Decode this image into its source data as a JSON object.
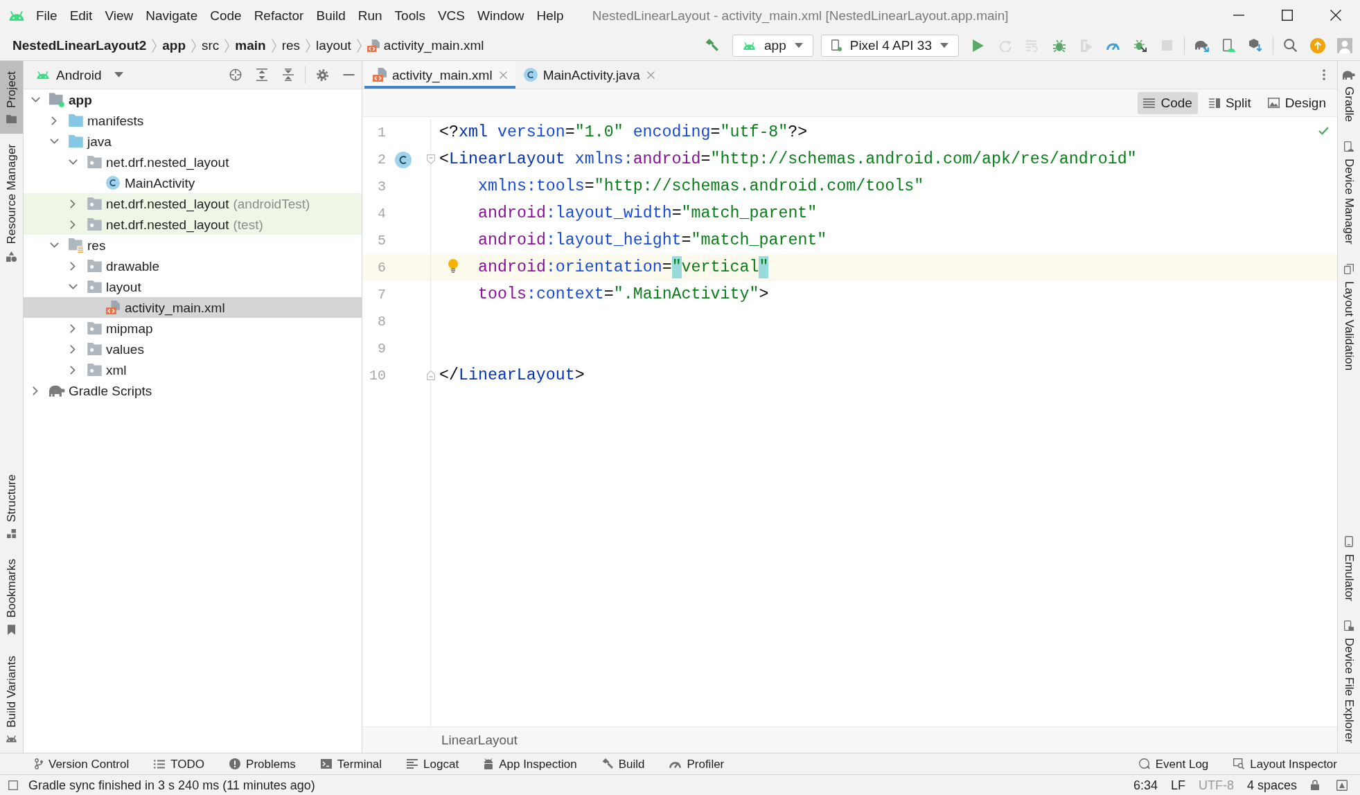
{
  "window": {
    "title": "NestedLinearLayout - activity_main.xml [NestedLinearLayout.app.main]"
  },
  "menu": [
    {
      "label": "File"
    },
    {
      "label": "Edit"
    },
    {
      "label": "View"
    },
    {
      "label": "Navigate"
    },
    {
      "label": "Code"
    },
    {
      "label": "Refactor"
    },
    {
      "label": "Build"
    },
    {
      "label": "Run"
    },
    {
      "label": "Tools"
    },
    {
      "label": "VCS"
    },
    {
      "label": "Window"
    },
    {
      "label": "Help"
    }
  ],
  "breadcrumbs": [
    {
      "label": "NestedLinearLayout2",
      "bold": true,
      "kind": "folder"
    },
    {
      "label": "app",
      "bold": true,
      "kind": "folder"
    },
    {
      "label": "src",
      "bold": false,
      "kind": "folder"
    },
    {
      "label": "main",
      "bold": true,
      "kind": "folder"
    },
    {
      "label": "res",
      "bold": false,
      "kind": "folder"
    },
    {
      "label": "layout",
      "bold": false,
      "kind": "folder"
    },
    {
      "label": "activity_main.xml",
      "bold": false,
      "kind": "layout-file"
    }
  ],
  "toolbar": {
    "make_button": {
      "disabled": false
    },
    "run_configuration": "app",
    "device": "Pixel 4 API 33",
    "groups": [
      {
        "buttons": [
          {
            "kind": "run",
            "disabled": false
          },
          {
            "kind": "rerun",
            "disabled": true
          },
          {
            "kind": "apply-code",
            "disabled": true
          },
          {
            "kind": "debug",
            "disabled": false
          },
          {
            "kind": "coverage",
            "disabled": true
          },
          {
            "kind": "profile",
            "disabled": false
          },
          {
            "kind": "attach-debugger",
            "disabled": false
          },
          {
            "kind": "stop",
            "disabled": true
          }
        ]
      },
      {
        "buttons": [
          {
            "kind": "sync",
            "disabled": false
          },
          {
            "kind": "device-manager",
            "disabled": false
          },
          {
            "kind": "sdk-manager",
            "disabled": false
          }
        ]
      },
      {
        "buttons": [
          {
            "kind": "search",
            "disabled": false
          },
          {
            "kind": "update",
            "disabled": false
          },
          {
            "kind": "account",
            "disabled": false
          }
        ]
      }
    ]
  },
  "left_strip": {
    "top": [
      {
        "label": "Project",
        "kind": "project",
        "selected": true
      },
      {
        "label": "Resource Manager",
        "kind": "resources",
        "selected": false
      }
    ],
    "bottom": [
      {
        "label": "Structure",
        "kind": "structure",
        "selected": false
      },
      {
        "label": "Bookmarks",
        "kind": "bookmarks",
        "selected": false
      },
      {
        "label": "Build Variants",
        "kind": "build-variants",
        "selected": false
      }
    ]
  },
  "project_panel": {
    "view": "Android",
    "tree": [
      {
        "label": "app",
        "kind": "module",
        "expanded": true,
        "selected": false,
        "highlighted": false,
        "children": [
          {
            "label": "manifests",
            "kind": "source-folder",
            "expanded": false,
            "selected": false,
            "highlighted": false
          },
          {
            "label": "java",
            "kind": "source-folder",
            "expanded": true,
            "selected": false,
            "highlighted": false,
            "children": [
              {
                "label": "net.drf.nested_layout",
                "kind": "folder",
                "expanded": true,
                "selected": false,
                "highlighted": false,
                "children": [
                  {
                    "label": "MainActivity",
                    "kind": "class",
                    "selected": false,
                    "highlighted": false
                  }
                ]
              },
              {
                "label": "net.drf.nested_layout",
                "suffix": "(androidTest)",
                "kind": "folder",
                "expanded": false,
                "selected": false,
                "highlighted": true
              },
              {
                "label": "net.drf.nested_layout",
                "suffix": "(test)",
                "kind": "folder",
                "expanded": false,
                "selected": false,
                "highlighted": true
              }
            ]
          },
          {
            "label": "res",
            "kind": "resource-folder",
            "expanded": true,
            "selected": false,
            "highlighted": false,
            "children": [
              {
                "label": "drawable",
                "kind": "folder",
                "expanded": false,
                "selected": false,
                "highlighted": false
              },
              {
                "label": "layout",
                "kind": "folder",
                "expanded": true,
                "selected": false,
                "highlighted": false,
                "children": [
                  {
                    "label": "activity_main.xml",
                    "kind": "layout-file",
                    "selected": true,
                    "highlighted": false
                  }
                ]
              },
              {
                "label": "mipmap",
                "kind": "folder",
                "expanded": false,
                "selected": false,
                "highlighted": false
              },
              {
                "label": "values",
                "kind": "folder",
                "expanded": false,
                "selected": false,
                "highlighted": false
              },
              {
                "label": "xml",
                "kind": "folder",
                "expanded": false,
                "selected": false,
                "highlighted": false
              }
            ]
          }
        ]
      },
      {
        "label": "Gradle Scripts",
        "kind": "gradle",
        "expanded": false,
        "selected": false,
        "highlighted": false
      }
    ]
  },
  "editor": {
    "tabs": [
      {
        "label": "activity_main.xml",
        "kind": "layout-file",
        "selected": true
      },
      {
        "label": "MainActivity.java",
        "kind": "class",
        "selected": false
      }
    ],
    "view_modes": [
      {
        "label": "Code",
        "kind": "code",
        "selected": true
      },
      {
        "label": "Split",
        "kind": "split",
        "selected": false
      },
      {
        "label": "Design",
        "kind": "design",
        "selected": false
      }
    ],
    "lines": [
      {
        "number": "1",
        "indented": false,
        "current": false,
        "tokens": [
          {
            "text": "<?",
            "kind": "punct"
          },
          {
            "text": "xml",
            "kind": "tag"
          },
          {
            "text": " version",
            "kind": "attr"
          },
          {
            "text": "=",
            "kind": "punct"
          },
          {
            "text": "\"1.0\"",
            "kind": "value"
          },
          {
            "text": " encoding",
            "kind": "attr"
          },
          {
            "text": "=",
            "kind": "punct"
          },
          {
            "text": "\"utf-8\"",
            "kind": "value"
          },
          {
            "text": "?>",
            "kind": "punct"
          }
        ]
      },
      {
        "number": "2",
        "indented": false,
        "current": false,
        "gutter_mark": {
          "kind": "class"
        },
        "fold_mark": {
          "kind": "start"
        },
        "tokens": [
          {
            "text": "<",
            "kind": "punct"
          },
          {
            "text": "LinearLayout",
            "kind": "tag"
          },
          {
            "text": " xmlns:",
            "kind": "attr"
          },
          {
            "text": "android",
            "kind": "ns"
          },
          {
            "text": "=",
            "kind": "punct"
          },
          {
            "text": "\"http://schemas.android.com/apk/res/android\"",
            "kind": "value"
          }
        ]
      },
      {
        "number": "3",
        "indented": true,
        "current": false,
        "tokens": [
          {
            "text": "xmlns:tools",
            "kind": "attr"
          },
          {
            "text": "=",
            "kind": "punct"
          },
          {
            "text": "\"http://schemas.android.com/tools\"",
            "kind": "value"
          }
        ]
      },
      {
        "number": "4",
        "indented": true,
        "current": false,
        "tokens": [
          {
            "text": "android",
            "kind": "ns"
          },
          {
            "text": ":layout_width",
            "kind": "attr"
          },
          {
            "text": "=",
            "kind": "punct"
          },
          {
            "text": "\"match_parent\"",
            "kind": "value"
          }
        ]
      },
      {
        "number": "5",
        "indented": true,
        "current": false,
        "tokens": [
          {
            "text": "android",
            "kind": "ns"
          },
          {
            "text": ":layout_height",
            "kind": "attr"
          },
          {
            "text": "=",
            "kind": "punct"
          },
          {
            "text": "\"match_parent\"",
            "kind": "value"
          }
        ]
      },
      {
        "number": "6",
        "indented": true,
        "current": true,
        "gutter_mark": {
          "kind": "bulb"
        },
        "tokens": [
          {
            "text": "android",
            "kind": "ns"
          },
          {
            "text": ":orientation",
            "kind": "attr"
          },
          {
            "text": "=",
            "kind": "punct"
          },
          {
            "text": "\"",
            "kind": "value",
            "matched": true
          },
          {
            "text": "vertical",
            "kind": "value"
          },
          {
            "text": "\"",
            "kind": "value",
            "matched": true
          }
        ]
      },
      {
        "number": "7",
        "indented": true,
        "current": false,
        "tokens": [
          {
            "text": "tools",
            "kind": "ns"
          },
          {
            "text": ":context",
            "kind": "attr"
          },
          {
            "text": "=",
            "kind": "punct"
          },
          {
            "text": "\".MainActivity\"",
            "kind": "value"
          },
          {
            "text": ">",
            "kind": "punct"
          }
        ]
      },
      {
        "number": "8",
        "current": false
      },
      {
        "number": "9",
        "current": false
      },
      {
        "number": "10",
        "indented": false,
        "current": false,
        "fold_mark": {
          "kind": "end"
        },
        "tokens": [
          {
            "text": "</",
            "kind": "punct"
          },
          {
            "text": "LinearLayout",
            "kind": "tag"
          },
          {
            "text": ">",
            "kind": "punct"
          }
        ]
      }
    ],
    "breadcrumb": "LinearLayout"
  },
  "right_strip": {
    "top": [
      {
        "label": "Gradle",
        "kind": "gradle",
        "selected": false
      },
      {
        "label": "Device Manager",
        "kind": "device-manager",
        "selected": false
      },
      {
        "label": "Layout Validation",
        "kind": "layout-validation",
        "selected": false
      }
    ],
    "bottom": [
      {
        "label": "Emulator",
        "kind": "emulator",
        "selected": false
      },
      {
        "label": "Device File Explorer",
        "kind": "device-file-explorer",
        "selected": false
      }
    ]
  },
  "tool_window_bar": {
    "left": [
      {
        "label": "Version Control",
        "kind": "vcs"
      },
      {
        "label": "TODO",
        "kind": "todo"
      },
      {
        "label": "Problems",
        "kind": "problems"
      },
      {
        "label": "Terminal",
        "kind": "terminal"
      },
      {
        "label": "Logcat",
        "kind": "logcat"
      },
      {
        "label": "App Inspection",
        "kind": "app-inspection"
      },
      {
        "label": "Build",
        "kind": "build"
      },
      {
        "label": "Profiler",
        "kind": "profiler"
      }
    ],
    "right": [
      {
        "label": "Event Log",
        "kind": "event-log"
      },
      {
        "label": "Layout Inspector",
        "kind": "layout-inspector"
      }
    ]
  },
  "status_bar": {
    "message": "Gradle sync finished in 3 s 240 ms (11 minutes ago)",
    "items": [
      {
        "label": "6:34",
        "disabled": false
      },
      {
        "label": "LF",
        "disabled": false
      },
      {
        "label": "UTF-8",
        "disabled": true
      },
      {
        "label": "4 spaces",
        "disabled": false
      }
    ]
  }
}
